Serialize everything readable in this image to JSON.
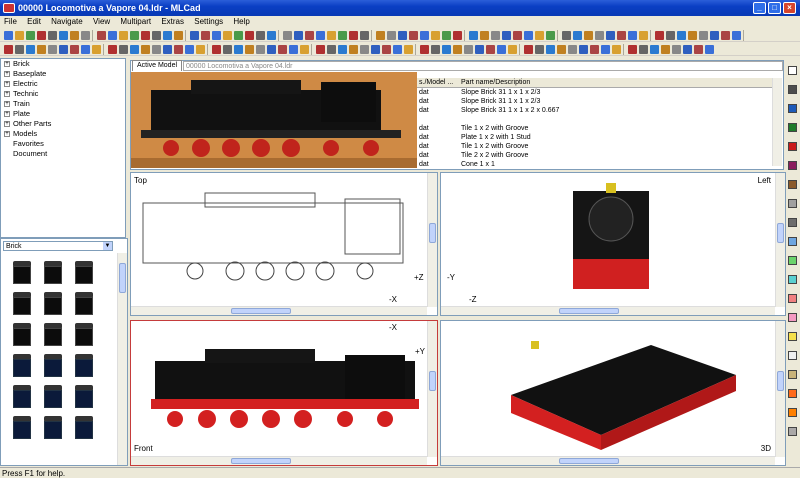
{
  "window": {
    "title": "00000 Locomotiva a Vapore 04.ldr - MLCad",
    "minimize": "_",
    "maximize": "□",
    "close": "×"
  },
  "menu": [
    "File",
    "Edit",
    "Navigate",
    "View",
    "Multipart",
    "Extras",
    "Settings",
    "Help"
  ],
  "tree": [
    {
      "label": "Brick",
      "expander": "+"
    },
    {
      "label": "Baseplate",
      "expander": "+"
    },
    {
      "label": "Electric",
      "expander": "+"
    },
    {
      "label": "Technic",
      "expander": "+"
    },
    {
      "label": "Train",
      "expander": "+"
    },
    {
      "label": "Plate",
      "expander": "+"
    },
    {
      "label": "Other Parts",
      "expander": "+"
    },
    {
      "label": "Models",
      "expander": "+"
    },
    {
      "label": "Favorites",
      "expander": ""
    },
    {
      "label": "Document",
      "expander": ""
    }
  ],
  "parts_combo": {
    "value": "Brick",
    "arrow": "▼"
  },
  "tabs": {
    "active": "Active Model",
    "model": "00000 Locomotiva a Vapore 04.ldr"
  },
  "grid": {
    "headers": [
      "s./Model ...",
      "Part name/Description"
    ],
    "rows": [
      {
        "file": "dat",
        "desc": "Slope Brick 31  1 x 1 x  2/3"
      },
      {
        "file": "dat",
        "desc": "Slope Brick 31  1 x 1 x  2/3"
      },
      {
        "file": "dat",
        "desc": "Slope Brick 31  1 x 1 x 2 x 0.667"
      },
      {
        "file": "",
        "desc": ""
      },
      {
        "file": "dat",
        "desc": "Tile  1 x  2 with Groove"
      },
      {
        "file": "dat",
        "desc": "Plate  1 x  2 with 1 Stud"
      },
      {
        "file": "dat",
        "desc": "Tile  1 x  2 with Groove"
      },
      {
        "file": "dat",
        "desc": "Tile  2 x  2 with Groove"
      },
      {
        "file": "dat",
        "desc": "Cone  1 x  1"
      }
    ]
  },
  "views": {
    "top": {
      "label": "Top",
      "axis_v": "+Z",
      "axis_h": "-X"
    },
    "left": {
      "label": "Left",
      "axis_v": "-Y",
      "axis_h": "-Z"
    },
    "front": {
      "label": "Front",
      "axis_h": "-X",
      "axis_v": "+Y"
    },
    "3d": {
      "label": "3D"
    }
  },
  "palette": [
    "#ffffff",
    "#4d4d4d",
    "#1e5bb8",
    "#1e7a2a",
    "#c91a1a",
    "#8a1d5c",
    "#8b5a2b",
    "#a0a0a0",
    "#6d6d6d",
    "#6ea6e0",
    "#6bd36b",
    "#5ad0d0",
    "#f08080",
    "#f49ac2",
    "#f5e04a",
    "#f0f0f0",
    "#c9b37a",
    "#ff6a1a",
    "#ff8000",
    "#aaa8a8"
  ],
  "status": {
    "text": "Press F1 for help."
  }
}
